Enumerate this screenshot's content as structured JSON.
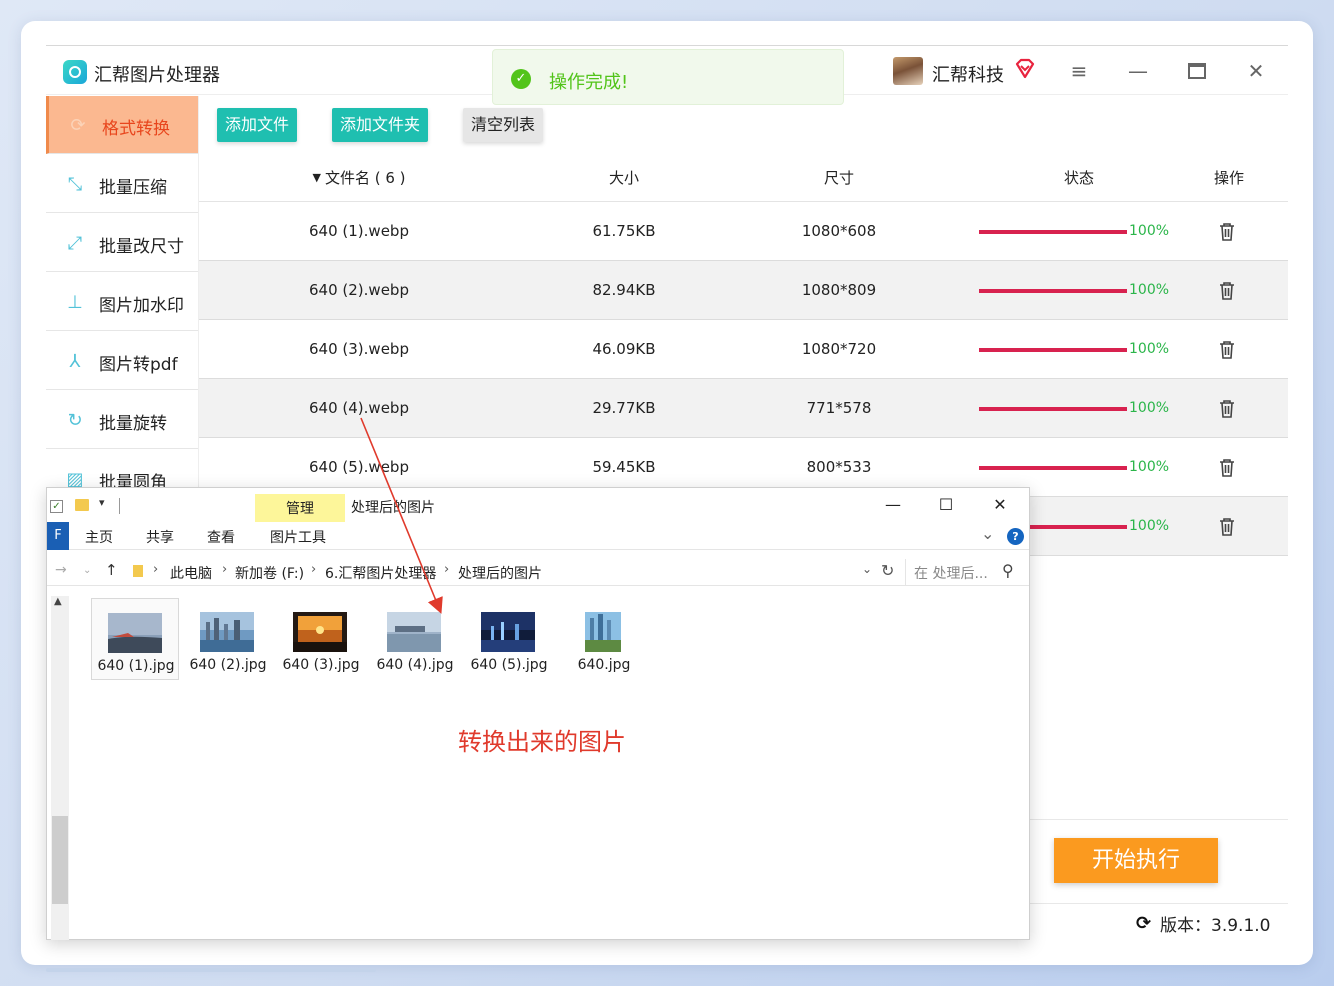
{
  "app": {
    "title": "汇帮图片处理器",
    "toast": "操作完成!",
    "company": "汇帮科技"
  },
  "sidebar": {
    "items": [
      {
        "label": "格式转换",
        "icon": "convert-icon",
        "active": true
      },
      {
        "label": "批量压缩",
        "icon": "compress-icon",
        "active": false
      },
      {
        "label": "批量改尺寸",
        "icon": "resize-icon",
        "active": false
      },
      {
        "label": "图片加水印",
        "icon": "watermark-icon",
        "active": false
      },
      {
        "label": "图片转pdf",
        "icon": "pdf-icon",
        "active": false
      },
      {
        "label": "批量旋转",
        "icon": "rotate-icon",
        "active": false
      },
      {
        "label": "批量圆角",
        "icon": "rounded-corner-icon",
        "active": false
      }
    ]
  },
  "toolbar": {
    "add_file": "添加文件",
    "add_folder": "添加文件夹",
    "clear_list": "清空列表"
  },
  "table": {
    "headers": {
      "name": "文件名 ( 6 )",
      "size": "大小",
      "dimensions": "尺寸",
      "status": "状态",
      "action": "操作"
    },
    "rows": [
      {
        "name": "640 (1).webp",
        "size": "61.75KB",
        "dimensions": "1080*608",
        "progress": 100,
        "progress_text": "100%"
      },
      {
        "name": "640 (2).webp",
        "size": "82.94KB",
        "dimensions": "1080*809",
        "progress": 100,
        "progress_text": "100%"
      },
      {
        "name": "640 (3).webp",
        "size": "46.09KB",
        "dimensions": "1080*720",
        "progress": 100,
        "progress_text": "100%"
      },
      {
        "name": "640 (4).webp",
        "size": "29.77KB",
        "dimensions": "771*578",
        "progress": 100,
        "progress_text": "100%"
      },
      {
        "name": "640 (5).webp",
        "size": "59.45KB",
        "dimensions": "800*533",
        "progress": 100,
        "progress_text": "100%"
      },
      {
        "name": "",
        "size": "",
        "dimensions": "",
        "progress": 100,
        "progress_text": "100%"
      }
    ]
  },
  "start_button": "开始执行",
  "version": "版本：3.9.1.0",
  "explorer": {
    "manage_tab": "管理",
    "title": "处理后的图片",
    "file_tab": "F",
    "ribbon_tabs": [
      "主页",
      "共享",
      "查看",
      "图片工具"
    ],
    "breadcrumb": [
      "此电脑",
      "新加卷 (F:)",
      "6.汇帮图片处理器",
      "处理后的图片"
    ],
    "search_placeholder": "在 处理后...",
    "files": [
      {
        "name": "640 (1).jpg",
        "selected": true
      },
      {
        "name": "640 (2).jpg",
        "selected": false
      },
      {
        "name": "640 (3).jpg",
        "selected": false
      },
      {
        "name": "640 (4).jpg",
        "selected": false
      },
      {
        "name": "640 (5).jpg",
        "selected": false
      },
      {
        "name": "640.jpg",
        "selected": false
      }
    ]
  },
  "annotation": "转换出来的图片",
  "colors": {
    "accent_teal": "#1fbfb0",
    "active_sidebar": "#fbb890",
    "progress": "#d8224f",
    "success": "#52c41a",
    "start_button": "#fb9a1f",
    "annotation": "#e03a2c"
  }
}
